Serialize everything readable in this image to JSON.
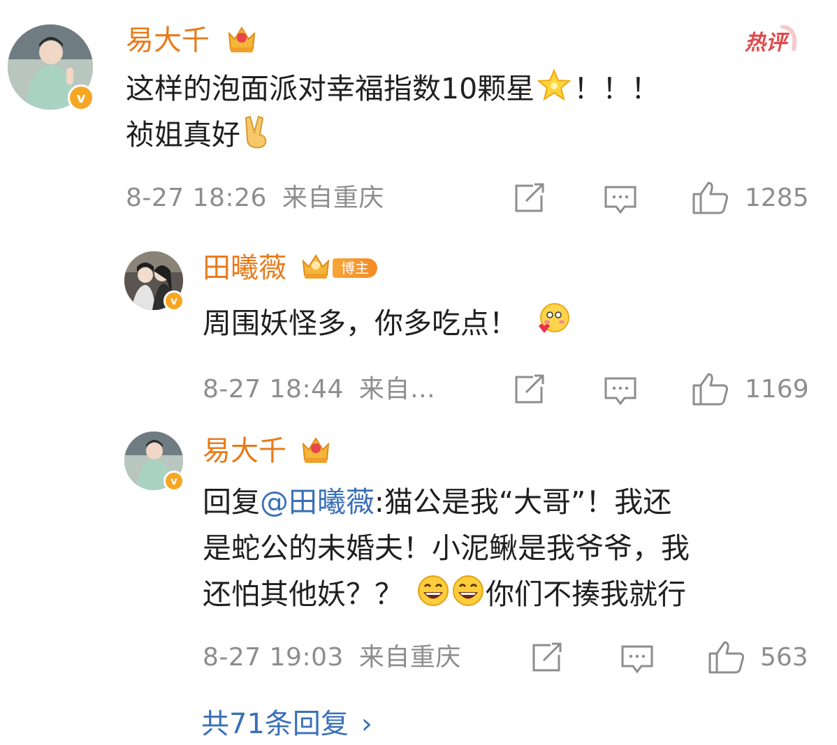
{
  "hot_badge": "热评",
  "comment": {
    "author": "易大千",
    "text_line1": "这样的泡面派对幸福指数10颗星",
    "text_line1_tail": "！！！",
    "text_line2": "祯姐真好",
    "time": "8-27 18:26",
    "location": "来自重庆",
    "likes": "1285"
  },
  "replies": [
    {
      "author": "田曦薇",
      "tag": "博主",
      "text": "周围妖怪多，你多吃点！",
      "time": "8-27 18:44",
      "location": "来自…",
      "likes": "1169"
    },
    {
      "author": "易大千",
      "prefix": "回复",
      "mention": "@田曦薇",
      "text_a": ":猫公是我“大哥”！我还",
      "text_b": "是蛇公的未婚夫！小泥鳅是我爷爷，我",
      "text_c": "还怕其他妖？？",
      "text_d": "你们不揍我就行",
      "time": "8-27 19:03",
      "location": "来自重庆",
      "likes": "563"
    }
  ],
  "more_replies": "共71条回复",
  "more_arrow": "›",
  "icons": [
    "share-icon",
    "comment-icon",
    "like-icon",
    "verified-icon",
    "crown-icon",
    "star-emoji",
    "victory-hand-emoji",
    "blush-emoji",
    "grin-emoji"
  ],
  "colors": {
    "name": "#e87a19",
    "mention": "#3a70b8",
    "meta": "#8d8d8d",
    "hot": "#e0484b",
    "badge": "#f6a623"
  }
}
